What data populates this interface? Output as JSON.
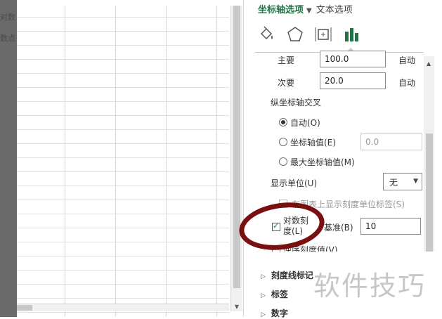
{
  "background": {
    "left_text": [
      "对数",
      "数点"
    ]
  },
  "pane": {
    "tabs": {
      "axis_options": "坐标轴选项",
      "text_options": "文本选项",
      "arrow": "▼"
    },
    "icons": [
      "fill-line-icon",
      "effects-pentagon-icon",
      "size-properties-icon",
      "axis-options-bar-chart-icon"
    ],
    "major": {
      "label": "主要",
      "value": "100.0",
      "auto": "自动"
    },
    "minor": {
      "label": "次要",
      "value": "20.0",
      "auto": "自动"
    },
    "cross": {
      "title": "纵坐标轴交叉",
      "auto": "自动(O)",
      "axis_value": "坐标轴值(E)",
      "axis_value_input": "0.0",
      "max_value": "最大坐标轴值(M)",
      "selected": "auto"
    },
    "display_units": {
      "label": "显示单位(U)",
      "value": "无"
    },
    "show_units_label": "在图表上显示刻度单位标签(S)",
    "log_scale": {
      "label_line1": "对数刻",
      "label_line2": "度(L)",
      "checked": true,
      "base_label": "基准(B)",
      "base_value": "10"
    },
    "reverse": {
      "label": "逆序刻度值(V)",
      "checked": false
    },
    "sections": [
      "刻度线标记",
      "标签",
      "数字"
    ]
  },
  "watermark": "软件技巧",
  "colors": {
    "accent": "#217346",
    "annotation": "#7a0f0f"
  }
}
